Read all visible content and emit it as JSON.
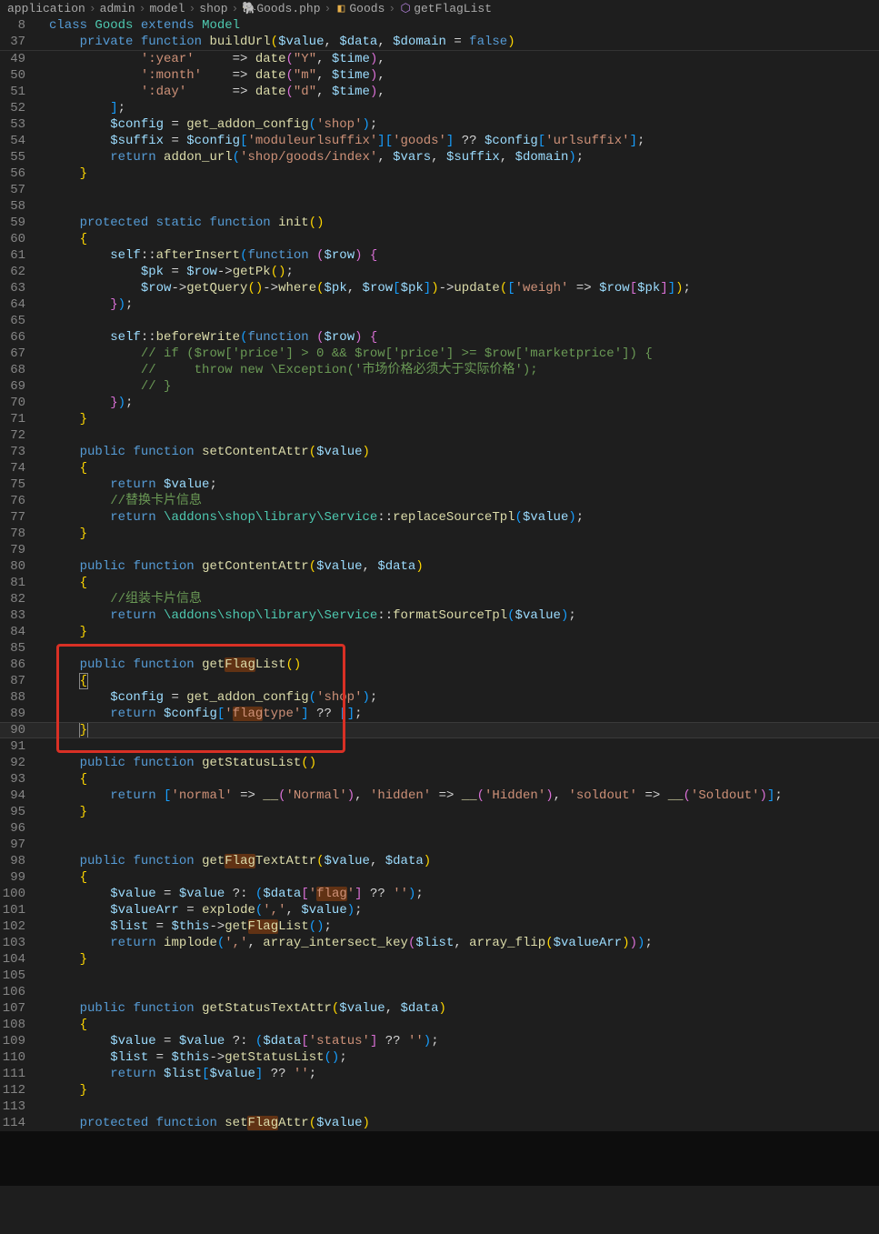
{
  "breadcrumb": {
    "items": [
      {
        "label": "application",
        "icon": ""
      },
      {
        "label": "admin",
        "icon": ""
      },
      {
        "label": "model",
        "icon": ""
      },
      {
        "label": "shop",
        "icon": ""
      },
      {
        "label": "Goods.php",
        "icon": "php"
      },
      {
        "label": "Goods",
        "icon": "class"
      },
      {
        "label": "getFlagList",
        "icon": "method"
      }
    ]
  },
  "sticky": [
    {
      "no": 8,
      "html": "<span class='tk-kw'>class</span> <span class='tk-type'>Goods</span> <span class='tk-kw'>extends</span> <span class='tk-type'>Model</span>"
    },
    {
      "no": 37,
      "html": "    <span class='tk-kw'>private</span> <span class='tk-kw'>function</span> <span class='tk-func'>buildUrl</span><span class='tk-brace3'>(</span><span class='tk-var'>$value</span><span class='tk-punc'>,</span> <span class='tk-var'>$data</span><span class='tk-punc'>,</span> <span class='tk-var'>$domain</span> <span class='tk-op'>=</span> <span class='tk-const'>false</span><span class='tk-brace3'>)</span>"
    }
  ],
  "lines": [
    {
      "no": 49,
      "html": "            <span class='tk-str'>':year'</span>     <span class='tk-op'>=&gt;</span> <span class='tk-func'>date</span><span class='tk-brace'>(</span><span class='tk-str'>\"Y\"</span><span class='tk-punc'>,</span> <span class='tk-var'>$time</span><span class='tk-brace'>)</span><span class='tk-punc'>,</span>"
    },
    {
      "no": 50,
      "html": "            <span class='tk-str'>':month'</span>    <span class='tk-op'>=&gt;</span> <span class='tk-func'>date</span><span class='tk-brace'>(</span><span class='tk-str'>\"m\"</span><span class='tk-punc'>,</span> <span class='tk-var'>$time</span><span class='tk-brace'>)</span><span class='tk-punc'>,</span>"
    },
    {
      "no": 51,
      "html": "            <span class='tk-str'>':day'</span>      <span class='tk-op'>=&gt;</span> <span class='tk-func'>date</span><span class='tk-brace'>(</span><span class='tk-str'>\"d\"</span><span class='tk-punc'>,</span> <span class='tk-var'>$time</span><span class='tk-brace'>)</span><span class='tk-punc'>,</span>"
    },
    {
      "no": 52,
      "html": "        <span class='tk-brace2'>]</span><span class='tk-punc'>;</span>"
    },
    {
      "no": 53,
      "html": "        <span class='tk-var'>$config</span> <span class='tk-op'>=</span> <span class='tk-func'>get_addon_config</span><span class='tk-brace2'>(</span><span class='tk-str'>'shop'</span><span class='tk-brace2'>)</span><span class='tk-punc'>;</span>"
    },
    {
      "no": 54,
      "html": "        <span class='tk-var'>$suffix</span> <span class='tk-op'>=</span> <span class='tk-var'>$config</span><span class='tk-brace2'>[</span><span class='tk-str'>'moduleurlsuffix'</span><span class='tk-brace2'>]</span><span class='tk-brace2'>[</span><span class='tk-str'>'goods'</span><span class='tk-brace2'>]</span> <span class='tk-op'>??</span> <span class='tk-var'>$config</span><span class='tk-brace2'>[</span><span class='tk-str'>'urlsuffix'</span><span class='tk-brace2'>]</span><span class='tk-punc'>;</span>"
    },
    {
      "no": 55,
      "html": "        <span class='tk-kw'>return</span> <span class='tk-func'>addon_url</span><span class='tk-brace2'>(</span><span class='tk-str'>'shop/goods/index'</span><span class='tk-punc'>,</span> <span class='tk-var'>$vars</span><span class='tk-punc'>,</span> <span class='tk-var'>$suffix</span><span class='tk-punc'>,</span> <span class='tk-var'>$domain</span><span class='tk-brace2'>)</span><span class='tk-punc'>;</span>"
    },
    {
      "no": 56,
      "html": "    <span class='tk-brace3'>}</span>"
    },
    {
      "no": 57,
      "html": ""
    },
    {
      "no": 58,
      "html": ""
    },
    {
      "no": 59,
      "html": "    <span class='tk-kw'>protected</span> <span class='tk-kw'>static</span> <span class='tk-kw'>function</span> <span class='tk-func'>init</span><span class='tk-brace3'>(</span><span class='tk-brace3'>)</span>"
    },
    {
      "no": 60,
      "html": "    <span class='tk-brace3'>{</span>"
    },
    {
      "no": 61,
      "html": "        <span class='tk-var'>self</span><span class='tk-punc'>::</span><span class='tk-func'>afterInsert</span><span class='tk-brace2'>(</span><span class='tk-kw'>function</span> <span class='tk-brace'>(</span><span class='tk-var'>$row</span><span class='tk-brace'>)</span> <span class='tk-brace'>{</span>"
    },
    {
      "no": 62,
      "html": "            <span class='tk-var'>$pk</span> <span class='tk-op'>=</span> <span class='tk-var'>$row</span><span class='tk-op'>-&gt;</span><span class='tk-func'>getPk</span><span class='tk-brace3'>(</span><span class='tk-brace3'>)</span><span class='tk-punc'>;</span>"
    },
    {
      "no": 63,
      "html": "            <span class='tk-var'>$row</span><span class='tk-op'>-&gt;</span><span class='tk-func'>getQuery</span><span class='tk-brace3'>(</span><span class='tk-brace3'>)</span><span class='tk-op'>-&gt;</span><span class='tk-func'>where</span><span class='tk-brace3'>(</span><span class='tk-var'>$pk</span><span class='tk-punc'>,</span> <span class='tk-var'>$row</span><span class='tk-brace2'>[</span><span class='tk-var'>$pk</span><span class='tk-brace2'>]</span><span class='tk-brace3'>)</span><span class='tk-op'>-&gt;</span><span class='tk-func'>update</span><span class='tk-brace3'>(</span><span class='tk-brace2'>[</span><span class='tk-str'>'weigh'</span> <span class='tk-op'>=&gt;</span> <span class='tk-var'>$row</span><span class='tk-brace'>[</span><span class='tk-var'>$pk</span><span class='tk-brace'>]</span><span class='tk-brace2'>]</span><span class='tk-brace3'>)</span><span class='tk-punc'>;</span>"
    },
    {
      "no": 64,
      "html": "        <span class='tk-brace'>}</span><span class='tk-brace2'>)</span><span class='tk-punc'>;</span>"
    },
    {
      "no": 65,
      "html": ""
    },
    {
      "no": 66,
      "html": "        <span class='tk-var'>self</span><span class='tk-punc'>::</span><span class='tk-func'>beforeWrite</span><span class='tk-brace2'>(</span><span class='tk-kw'>function</span> <span class='tk-brace'>(</span><span class='tk-var'>$row</span><span class='tk-brace'>)</span> <span class='tk-brace'>{</span>"
    },
    {
      "no": 67,
      "html": "            <span class='tk-com'>// if ($row['price'] &gt; 0 &amp;&amp; $row['price'] &gt;= $row['marketprice']) {</span>"
    },
    {
      "no": 68,
      "html": "            <span class='tk-com'>//     throw new \\Exception('市场价格必须大于实际价格');</span>"
    },
    {
      "no": 69,
      "html": "            <span class='tk-com'>// }</span>"
    },
    {
      "no": 70,
      "html": "        <span class='tk-brace'>}</span><span class='tk-brace2'>)</span><span class='tk-punc'>;</span>"
    },
    {
      "no": 71,
      "html": "    <span class='tk-brace3'>}</span>"
    },
    {
      "no": 72,
      "html": ""
    },
    {
      "no": 73,
      "html": "    <span class='tk-kw'>public</span> <span class='tk-kw'>function</span> <span class='tk-func'>setContentAttr</span><span class='tk-brace3'>(</span><span class='tk-var'>$value</span><span class='tk-brace3'>)</span>"
    },
    {
      "no": 74,
      "html": "    <span class='tk-brace3'>{</span>"
    },
    {
      "no": 75,
      "html": "        <span class='tk-kw'>return</span> <span class='tk-var'>$value</span><span class='tk-punc'>;</span>"
    },
    {
      "no": 76,
      "html": "        <span class='tk-com'>//替换卡片信息</span>"
    },
    {
      "no": 77,
      "html": "        <span class='tk-kw'>return</span> <span class='tk-type'>\\addons\\shop\\library\\Service</span><span class='tk-punc'>::</span><span class='tk-func'>replaceSourceTpl</span><span class='tk-brace2'>(</span><span class='tk-var'>$value</span><span class='tk-brace2'>)</span><span class='tk-punc'>;</span>"
    },
    {
      "no": 78,
      "html": "    <span class='tk-brace3'>}</span>"
    },
    {
      "no": 79,
      "html": ""
    },
    {
      "no": 80,
      "html": "    <span class='tk-kw'>public</span> <span class='tk-kw'>function</span> <span class='tk-func'>getContentAttr</span><span class='tk-brace3'>(</span><span class='tk-var'>$value</span><span class='tk-punc'>,</span> <span class='tk-var'>$data</span><span class='tk-brace3'>)</span>"
    },
    {
      "no": 81,
      "html": "    <span class='tk-brace3'>{</span>"
    },
    {
      "no": 82,
      "html": "        <span class='tk-com'>//组装卡片信息</span>"
    },
    {
      "no": 83,
      "html": "        <span class='tk-kw'>return</span> <span class='tk-type'>\\addons\\shop\\library\\Service</span><span class='tk-punc'>::</span><span class='tk-func'>formatSourceTpl</span><span class='tk-brace2'>(</span><span class='tk-var'>$value</span><span class='tk-brace2'>)</span><span class='tk-punc'>;</span>"
    },
    {
      "no": 84,
      "html": "    <span class='tk-brace3'>}</span>"
    },
    {
      "no": 85,
      "html": ""
    },
    {
      "no": 86,
      "html": "    <span class='tk-kw'>public</span> <span class='tk-kw'>function</span> <span class='tk-func'>get<span class='hl'>Flag</span>List</span><span class='tk-brace3'>(</span><span class='tk-brace3'>)</span>"
    },
    {
      "no": 87,
      "html": "    <span class='tk-brace3 bracket-match'>{</span>"
    },
    {
      "no": 88,
      "html": "        <span class='tk-var'>$config</span> <span class='tk-op'>=</span> <span class='tk-func'>get_addon_config</span><span class='tk-brace2'>(</span><span class='tk-str'>'shop'</span><span class='tk-brace2'>)</span><span class='tk-punc'>;</span>"
    },
    {
      "no": 89,
      "html": "        <span class='tk-kw'>return</span> <span class='tk-var'>$config</span><span class='tk-brace2'>[</span><span class='tk-str'>'<span class='hl'>flag</span>type'</span><span class='tk-brace2'>]</span> <span class='tk-op'>??</span> <span class='tk-brace2'>[</span><span class='tk-brace2'>]</span><span class='tk-punc'>;</span>"
    },
    {
      "no": 90,
      "html": "    <span class='tk-brace3 bracket-match'>}</span>",
      "cursor": true
    },
    {
      "no": 91,
      "html": ""
    },
    {
      "no": 92,
      "html": "    <span class='tk-kw'>public</span> <span class='tk-kw'>function</span> <span class='tk-func'>getStatusList</span><span class='tk-brace3'>(</span><span class='tk-brace3'>)</span>"
    },
    {
      "no": 93,
      "html": "    <span class='tk-brace3'>{</span>"
    },
    {
      "no": 94,
      "html": "        <span class='tk-kw'>return</span> <span class='tk-brace2'>[</span><span class='tk-str'>'normal'</span> <span class='tk-op'>=&gt;</span> <span class='tk-func'>__</span><span class='tk-brace'>(</span><span class='tk-str'>'Normal'</span><span class='tk-brace'>)</span><span class='tk-punc'>,</span> <span class='tk-str'>'hidden'</span> <span class='tk-op'>=&gt;</span> <span class='tk-func'>__</span><span class='tk-brace'>(</span><span class='tk-str'>'Hidden'</span><span class='tk-brace'>)</span><span class='tk-punc'>,</span> <span class='tk-str'>'soldout'</span> <span class='tk-op'>=&gt;</span> <span class='tk-func'>__</span><span class='tk-brace'>(</span><span class='tk-str'>'Soldout'</span><span class='tk-brace'>)</span><span class='tk-brace2'>]</span><span class='tk-punc'>;</span>"
    },
    {
      "no": 95,
      "html": "    <span class='tk-brace3'>}</span>"
    },
    {
      "no": 96,
      "html": ""
    },
    {
      "no": 97,
      "html": ""
    },
    {
      "no": 98,
      "html": "    <span class='tk-kw'>public</span> <span class='tk-kw'>function</span> <span class='tk-func'>get<span class='hl'>Flag</span>TextAttr</span><span class='tk-brace3'>(</span><span class='tk-var'>$value</span><span class='tk-punc'>,</span> <span class='tk-var'>$data</span><span class='tk-brace3'>)</span>"
    },
    {
      "no": 99,
      "html": "    <span class='tk-brace3'>{</span>"
    },
    {
      "no": 100,
      "html": "        <span class='tk-var'>$value</span> <span class='tk-op'>=</span> <span class='tk-var'>$value</span> <span class='tk-op'>?:</span> <span class='tk-brace2'>(</span><span class='tk-var'>$data</span><span class='tk-brace'>[</span><span class='tk-str'>'<span class='hl'>flag</span>'</span><span class='tk-brace'>]</span> <span class='tk-op'>??</span> <span class='tk-str'>''</span><span class='tk-brace2'>)</span><span class='tk-punc'>;</span>"
    },
    {
      "no": 101,
      "html": "        <span class='tk-var'>$valueArr</span> <span class='tk-op'>=</span> <span class='tk-func'>explode</span><span class='tk-brace2'>(</span><span class='tk-str'>','</span><span class='tk-punc'>,</span> <span class='tk-var'>$value</span><span class='tk-brace2'>)</span><span class='tk-punc'>;</span>"
    },
    {
      "no": 102,
      "html": "        <span class='tk-var'>$list</span> <span class='tk-op'>=</span> <span class='tk-var'>$this</span><span class='tk-op'>-&gt;</span><span class='tk-func'>get<span class='hl'>Flag</span>List</span><span class='tk-brace2'>(</span><span class='tk-brace2'>)</span><span class='tk-punc'>;</span>"
    },
    {
      "no": 103,
      "html": "        <span class='tk-kw'>return</span> <span class='tk-func'>implode</span><span class='tk-brace2'>(</span><span class='tk-str'>','</span><span class='tk-punc'>,</span> <span class='tk-func'>array_intersect_key</span><span class='tk-brace'>(</span><span class='tk-var'>$list</span><span class='tk-punc'>,</span> <span class='tk-func'>array_flip</span><span class='tk-brace3'>(</span><span class='tk-var'>$valueArr</span><span class='tk-brace3'>)</span><span class='tk-brace'>)</span><span class='tk-brace2'>)</span><span class='tk-punc'>;</span>"
    },
    {
      "no": 104,
      "html": "    <span class='tk-brace3'>}</span>"
    },
    {
      "no": 105,
      "html": ""
    },
    {
      "no": 106,
      "html": ""
    },
    {
      "no": 107,
      "html": "    <span class='tk-kw'>public</span> <span class='tk-kw'>function</span> <span class='tk-func'>getStatusTextAttr</span><span class='tk-brace3'>(</span><span class='tk-var'>$value</span><span class='tk-punc'>,</span> <span class='tk-var'>$data</span><span class='tk-brace3'>)</span>"
    },
    {
      "no": 108,
      "html": "    <span class='tk-brace3'>{</span>"
    },
    {
      "no": 109,
      "html": "        <span class='tk-var'>$value</span> <span class='tk-op'>=</span> <span class='tk-var'>$value</span> <span class='tk-op'>?:</span> <span class='tk-brace2'>(</span><span class='tk-var'>$data</span><span class='tk-brace'>[</span><span class='tk-str'>'status'</span><span class='tk-brace'>]</span> <span class='tk-op'>??</span> <span class='tk-str'>''</span><span class='tk-brace2'>)</span><span class='tk-punc'>;</span>"
    },
    {
      "no": 110,
      "html": "        <span class='tk-var'>$list</span> <span class='tk-op'>=</span> <span class='tk-var'>$this</span><span class='tk-op'>-&gt;</span><span class='tk-func'>getStatusList</span><span class='tk-brace2'>(</span><span class='tk-brace2'>)</span><span class='tk-punc'>;</span>"
    },
    {
      "no": 111,
      "html": "        <span class='tk-kw'>return</span> <span class='tk-var'>$list</span><span class='tk-brace2'>[</span><span class='tk-var'>$value</span><span class='tk-brace2'>]</span> <span class='tk-op'>??</span> <span class='tk-str'>''</span><span class='tk-punc'>;</span>"
    },
    {
      "no": 112,
      "html": "    <span class='tk-brace3'>}</span>"
    },
    {
      "no": 113,
      "html": ""
    },
    {
      "no": 114,
      "html": "    <span class='tk-kw'>protected</span> <span class='tk-kw'>function</span> <span class='tk-func'>set<span class='hl'>Flag</span>Attr</span><span class='tk-brace3'>(</span><span class='tk-var'>$value</span><span class='tk-brace3'>)</span>"
    }
  ],
  "highlight": {
    "top_line": 85,
    "bottom_line": 91
  }
}
